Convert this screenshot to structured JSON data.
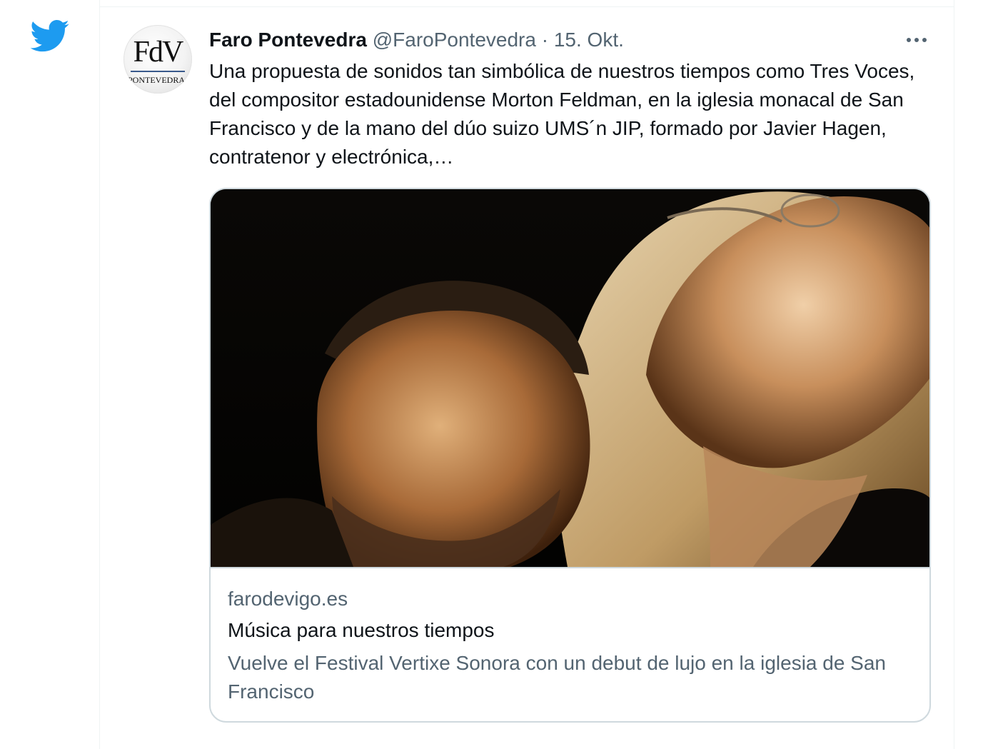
{
  "icons": {
    "app_logo": "twitter-bird-icon",
    "more": "more-horizontal-icon"
  },
  "colors": {
    "brand_blue": "#1d9bf0",
    "text_primary": "#0f1419",
    "text_secondary": "#536471",
    "border": "#cfd9de"
  },
  "tweet": {
    "avatar": {
      "letters": "FdV",
      "subtext": "PONTEVEDRA"
    },
    "display_name": "Faro Pontevedra",
    "handle": "@FaroPontevedra",
    "separator": "·",
    "date": "15. Okt.",
    "text": "Una propuesta de sonidos tan simbólica de nuestros tiempos como Tres Voces, del compositor estadounidense Morton Feldman, en la iglesia monacal de San Francisco y de la mano del dúo suizo UMS´n JIP, formado por Javier Hagen, contratenor y electrónica,…",
    "card": {
      "domain": "farodevigo.es",
      "title": "Música para nuestros tiempos",
      "description": "Vuelve el Festival Vertixe Sonora con un debut de lujo en la iglesia de San Francisco"
    }
  }
}
